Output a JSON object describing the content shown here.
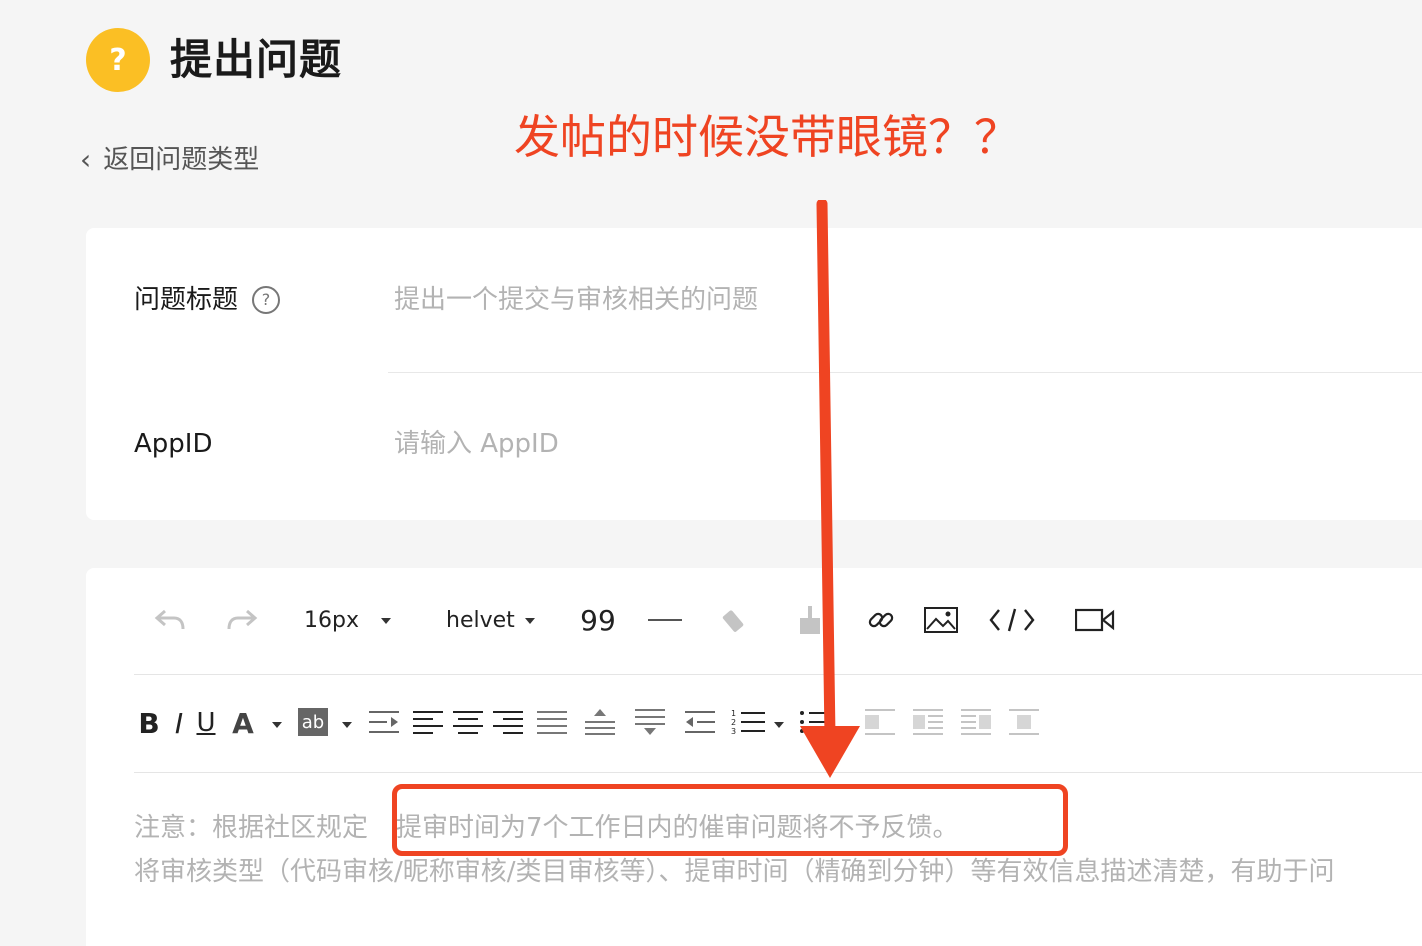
{
  "header": {
    "badge_glyph": "?",
    "title": "提出问题"
  },
  "nav": {
    "back_label": "返回问题类型",
    "back_chevron": "‹"
  },
  "annotation": {
    "text": "发帖的时候没带眼镜？？",
    "color": "#ef4422"
  },
  "form": {
    "title_field": {
      "label": "问题标题",
      "help_glyph": "?",
      "placeholder": "提出一个提交与审核相关的问题",
      "value": ""
    },
    "appid_field": {
      "label": "AppID",
      "placeholder": "请输入 AppID",
      "value": ""
    }
  },
  "editor": {
    "toolbar1": {
      "font_size": "16px",
      "font_family": "helvet",
      "quote_glyph": "99",
      "icons": [
        "undo-icon",
        "redo-icon",
        "eraser-icon",
        "format-brush-icon",
        "link-icon",
        "image-icon",
        "code-icon",
        "video-icon"
      ]
    },
    "toolbar2": {
      "bold": "B",
      "italic": "I",
      "underline": "U",
      "font_color": "A",
      "bg_color": "ab",
      "icons": [
        "indent-icon",
        "align-left-icon",
        "align-center-icon",
        "align-right-icon",
        "align-justify-icon",
        "line-height-top-icon",
        "line-height-middle-icon",
        "outdent-icon",
        "ordered-list-icon",
        "unordered-list-icon",
        "float-left-icon",
        "float-inline-icon",
        "float-right-icon",
        "float-center-icon"
      ]
    },
    "hint_line1_a": "注意：根据社区规定",
    "hint_line1_b": "提审时间为7个工作日内的催审问题将不予反馈。",
    "hint_line2": "将审核类型（代码审核/昵称审核/类目审核等）、提审时间（精确到分钟）等有效信息描述清楚，有助于问"
  },
  "colors": {
    "badge": "#fbbf24",
    "accent_red": "#ef4422",
    "placeholder": "#b3b3b3"
  }
}
